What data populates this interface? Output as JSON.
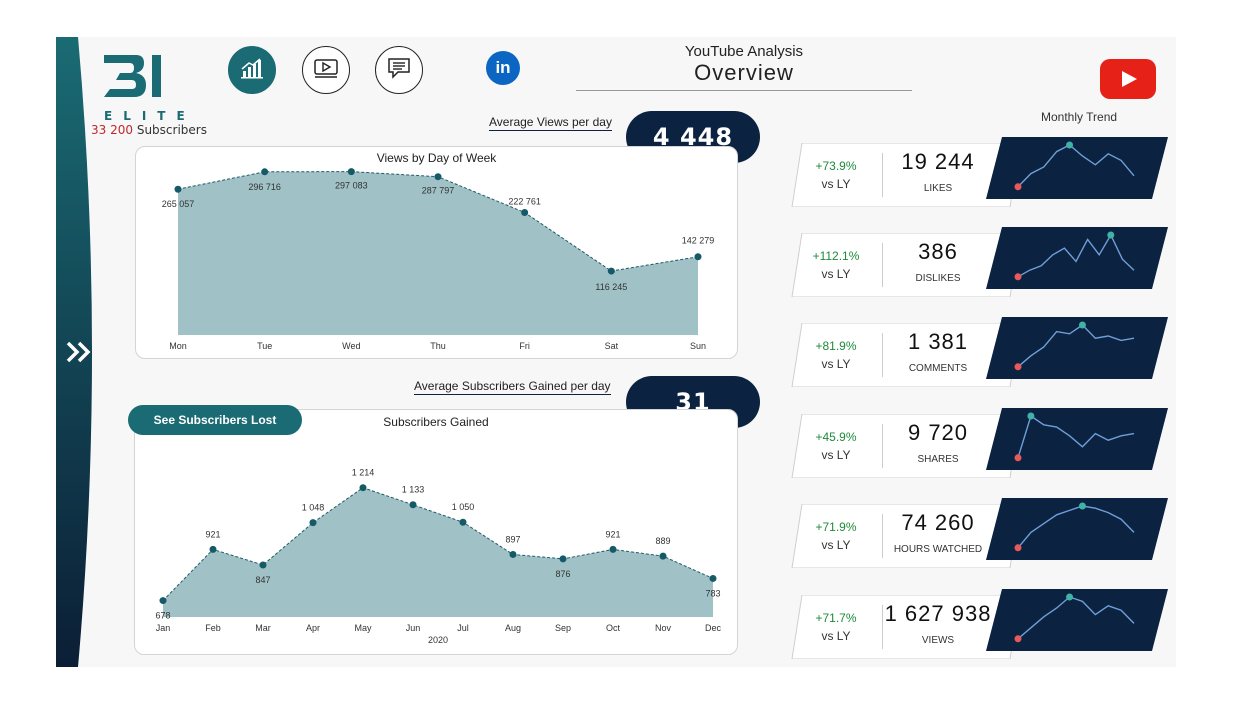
{
  "header": {
    "subtitle": "YouTube Analysis",
    "title": "Overview",
    "linkedin_label": "in",
    "logo_text": "ELITE",
    "subscribers_count": "33 200",
    "subscribers_label": "Subscribers"
  },
  "nav": {
    "items": [
      {
        "name": "analytics",
        "active": true
      },
      {
        "name": "videos",
        "active": false
      },
      {
        "name": "comments",
        "active": false
      }
    ]
  },
  "colors": {
    "navy": "#0b2240",
    "teal": "#1a6b73",
    "area_fill": "#a0c1c5",
    "positive": "#1f8a3a",
    "youtube": "#e62117"
  },
  "views_section": {
    "kpi_label": "Average Views per day",
    "kpi_value": "4 448",
    "chart_title": "Views by Day of Week"
  },
  "subs_section": {
    "kpi_label": "Average Subscribers Gained per day",
    "kpi_value": "31",
    "chart_title": "Subscribers Gained",
    "button_label": "See Subscribers Lost"
  },
  "monthly_trend_label": "Monthly Trend",
  "metrics": [
    {
      "pct": "+73.9%",
      "vsly": "vs LY",
      "value": "19 244",
      "label": "LIKES"
    },
    {
      "pct": "+112.1%",
      "vsly": "vs LY",
      "value": "386",
      "label": "DISLIKES"
    },
    {
      "pct": "+81.9%",
      "vsly": "vs LY",
      "value": "1 381",
      "label": "COMMENTS"
    },
    {
      "pct": "+45.9%",
      "vsly": "vs LY",
      "value": "9 720",
      "label": "SHARES"
    },
    {
      "pct": "+71.9%",
      "vsly": "vs LY",
      "value": "74 260",
      "label": "HOURS WATCHED"
    },
    {
      "pct": "+71.7%",
      "vsly": "vs LY",
      "value": "1 627 938",
      "label": "VIEWS"
    }
  ],
  "chart_data": [
    {
      "type": "area",
      "title": "Views by Day of Week",
      "categories": [
        "Mon",
        "Tue",
        "Wed",
        "Thu",
        "Fri",
        "Sat",
        "Sun"
      ],
      "values": [
        265057,
        296716,
        297083,
        287797,
        222761,
        116245,
        142279
      ],
      "labels": [
        "265 057",
        "296 716",
        "297 083",
        "287 797",
        "222 761",
        "116 245",
        "142 279"
      ],
      "ylim": [
        0,
        320000
      ]
    },
    {
      "type": "area",
      "title": "Subscribers Gained",
      "xlabel": "2020",
      "categories": [
        "Jan",
        "Feb",
        "Mar",
        "Apr",
        "May",
        "Jun",
        "Jul",
        "Aug",
        "Sep",
        "Oct",
        "Nov",
        "Dec"
      ],
      "values": [
        678,
        921,
        847,
        1048,
        1214,
        1133,
        1050,
        897,
        876,
        921,
        889,
        783
      ],
      "labels": [
        "678",
        "921",
        "847",
        "1 048",
        "1 214",
        "1 133",
        "1 050",
        "897",
        "876",
        "921",
        "889",
        "783"
      ],
      "ylim": [
        600,
        1260
      ]
    }
  ],
  "sparklines": [
    [
      0.05,
      0.35,
      0.5,
      0.85,
      1.0,
      0.75,
      0.55,
      0.8,
      0.65,
      0.3
    ],
    [
      0.05,
      0.2,
      0.3,
      0.55,
      0.7,
      0.4,
      0.9,
      0.55,
      1.0,
      0.45,
      0.2
    ],
    [
      0.05,
      0.3,
      0.5,
      0.85,
      0.8,
      1.0,
      0.7,
      0.75,
      0.65,
      0.7
    ],
    [
      0.05,
      1.0,
      0.8,
      0.75,
      0.55,
      0.3,
      0.6,
      0.45,
      0.55,
      0.6
    ],
    [
      0.05,
      0.4,
      0.6,
      0.8,
      0.9,
      1.0,
      0.95,
      0.85,
      0.7,
      0.4
    ],
    [
      0.05,
      0.3,
      0.55,
      0.75,
      1.0,
      0.9,
      0.6,
      0.8,
      0.7,
      0.4
    ]
  ],
  "spark_highlight": [
    4,
    8,
    5,
    1,
    5,
    4
  ]
}
